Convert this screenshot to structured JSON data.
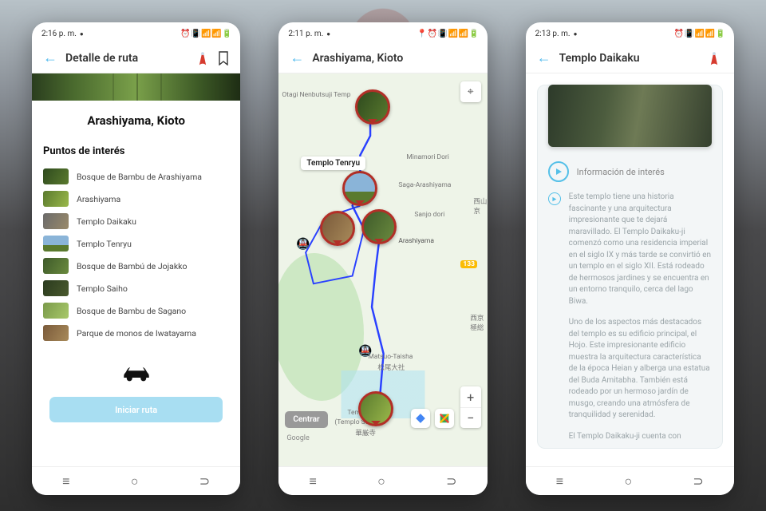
{
  "screen1": {
    "status_time": "2:16 p. m.",
    "header_title": "Detalle de ruta",
    "route_title": "Arashiyama, Kioto",
    "section_title": "Puntos de interés",
    "poi": [
      {
        "label": "Bosque de Bambu de Arashiyama",
        "thumb": "t-green1"
      },
      {
        "label": "Arashiyama",
        "thumb": "t-green2"
      },
      {
        "label": "Templo Daikaku",
        "thumb": "t-temple"
      },
      {
        "label": "Templo Tenryu",
        "thumb": "t-sky"
      },
      {
        "label": "Bosque de Bambú de Jojakko",
        "thumb": "t-bamboo"
      },
      {
        "label": "Templo Saiho",
        "thumb": "t-dark"
      },
      {
        "label": "Bosque de Bambu de Sagano",
        "thumb": "t-light"
      },
      {
        "label": "Parque de monos de Iwatayama",
        "thumb": "t-brown"
      }
    ],
    "start_button": "Iniciar ruta"
  },
  "screen2": {
    "status_time": "2:11 p. m.",
    "header_title": "Arashiyama, Kioto",
    "callout": "Templo Tenryu",
    "center_button": "Centrar",
    "google": "Google",
    "labels": {
      "otagi": "Otagi Nenbutsuji Temp",
      "saga": "Saga-Arashiyama",
      "sanjo": "Sanjo dori",
      "arashiyama": "Arashiyama",
      "matsuo": "Matsuo-Taisha",
      "matsuo_jp": "松尾大社",
      "tenryu": "Templo K",
      "suzumi": "(Templo Suzumi",
      "kanji": "華厳寺",
      "nishiyama": "西山京",
      "nishi": "西京極総",
      "route133": "133",
      "minamori": "Minamori Dori"
    }
  },
  "screen3": {
    "status_time": "2:13 p. m.",
    "header_title": "Templo Daikaku",
    "info_label": "Información de interés",
    "paragraph1": "Este templo tiene una historia fascinante y una arquitectura impresionante que te dejará maravillado. El Templo Daikaku-ji comenzó como una residencia imperial en el siglo IX y más tarde se convirtió en un templo en el siglo XII. Está rodeado de hermosos jardines y se encuentra en un entorno tranquilo, cerca del lago Biwa.",
    "paragraph2": "Uno de los aspectos más destacados del templo es su edificio principal, el Hojo. Este impresionante edificio muestra la arquitectura característica de la época Heian y alberga una estatua del Buda Amitabha. También está rodeado por un hermoso jardín de musgo, creando una atmósfera de tranquilidad y serenidad.",
    "paragraph3": "El Templo Daikaku-ji cuenta con"
  }
}
